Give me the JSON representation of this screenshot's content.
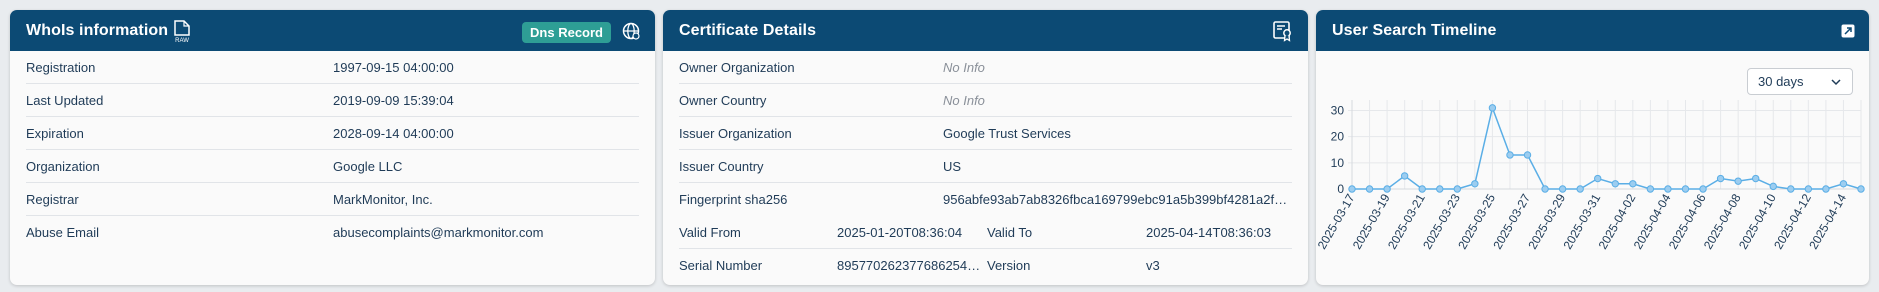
{
  "whois": {
    "title": "WhoIs information",
    "raw_label": "RAW",
    "dns_button": "Dns Record",
    "rows": [
      {
        "label": "Registration",
        "value": "1997-09-15 04:00:00"
      },
      {
        "label": "Last Updated",
        "value": "2019-09-09 15:39:04"
      },
      {
        "label": "Expiration",
        "value": "2028-09-14 04:00:00"
      },
      {
        "label": "Organization",
        "value": "Google LLC"
      },
      {
        "label": "Registrar",
        "value": "MarkMonitor, Inc."
      },
      {
        "label": "Abuse Email",
        "value": "abusecomplaints@markmonitor.com"
      }
    ]
  },
  "certificate": {
    "title": "Certificate Details",
    "rows": [
      {
        "label": "Owner Organization",
        "value": "No Info"
      },
      {
        "label": "Owner Country",
        "value": "No Info"
      },
      {
        "label": "Issuer Organization",
        "value": "Google Trust Services"
      },
      {
        "label": "Issuer Country",
        "value": "US"
      },
      {
        "label": "Fingerprint sha256",
        "value": "956abfe93ab7ab8326fbca169799ebc91a5b399bf4281a2f…"
      }
    ],
    "valid_from_label": "Valid From",
    "valid_from": "2025-01-20T08:36:04",
    "valid_to_label": "Valid To",
    "valid_to": "2025-04-14T08:36:03",
    "serial_label": "Serial Number",
    "serial": "8957702623776862542…",
    "version_label": "Version",
    "version": "v3"
  },
  "timeline": {
    "title": "User Search Timeline",
    "range_selected": "30 days"
  },
  "colors": {
    "header": "#0c4a74",
    "badge": "#2e9e95",
    "line": "#5aaee6"
  },
  "chart_data": {
    "type": "line",
    "x": [
      "2025-03-17",
      "2025-03-18",
      "2025-03-19",
      "2025-03-20",
      "2025-03-21",
      "2025-03-22",
      "2025-03-23",
      "2025-03-24",
      "2025-03-25",
      "2025-03-26",
      "2025-03-27",
      "2025-03-28",
      "2025-03-29",
      "2025-03-30",
      "2025-03-31",
      "2025-04-01",
      "2025-04-02",
      "2025-04-03",
      "2025-04-04",
      "2025-04-05",
      "2025-04-06",
      "2025-04-07",
      "2025-04-08",
      "2025-04-09",
      "2025-04-10",
      "2025-04-11",
      "2025-04-12",
      "2025-04-13",
      "2025-04-14",
      "2025-04-15"
    ],
    "x_tick_labels": [
      "2025-03-17",
      "2025-03-19",
      "2025-03-21",
      "2025-03-23",
      "2025-03-25",
      "2025-03-27",
      "2025-03-29",
      "2025-03-31",
      "2025-04-02",
      "2025-04-04",
      "2025-04-06",
      "2025-04-08",
      "2025-04-10",
      "2025-04-12",
      "2025-04-14"
    ],
    "values": [
      0,
      0,
      0,
      5,
      0,
      0,
      0,
      2,
      31,
      13,
      13,
      0,
      0,
      0,
      4,
      2,
      2,
      0,
      0,
      0,
      0,
      4,
      3,
      4,
      1,
      0,
      0,
      0,
      2,
      0
    ],
    "y_ticks": [
      0,
      10,
      20,
      30
    ],
    "ylim": [
      0,
      34
    ],
    "grid": true,
    "legend": "none"
  }
}
